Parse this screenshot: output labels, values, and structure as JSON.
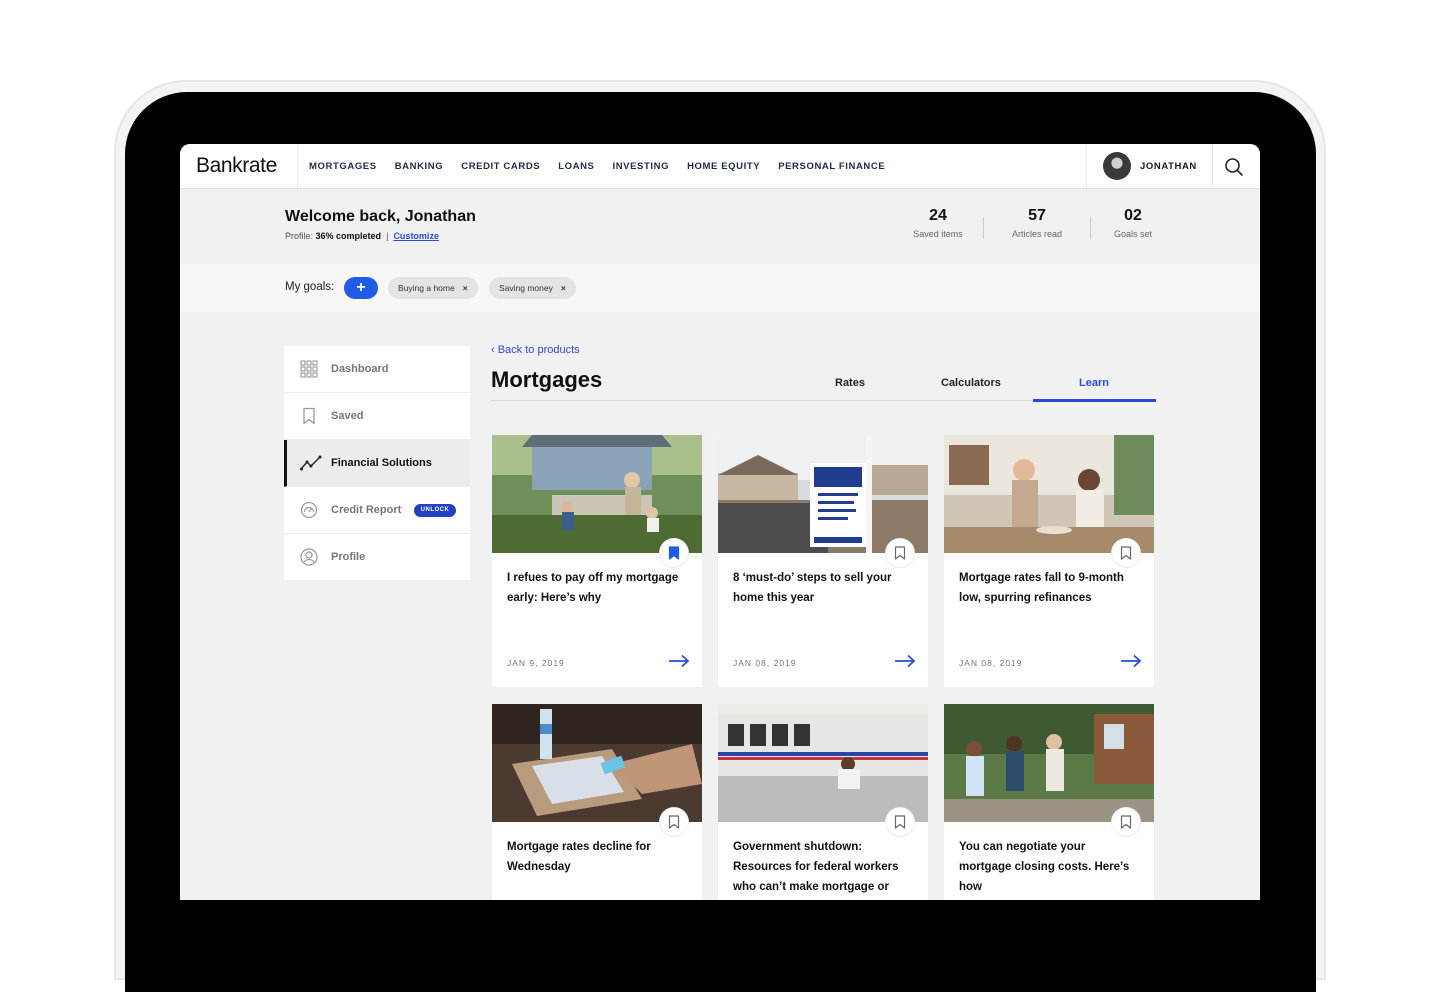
{
  "brand": {
    "logo": "Bankrate"
  },
  "nav": {
    "items": [
      "MORTGAGES",
      "BANKING",
      "CREDIT CARDS",
      "LOANS",
      "INVESTING",
      "HOME EQUITY",
      "PERSONAL FINANCE"
    ],
    "user_name": "JONATHAN"
  },
  "welcome": {
    "title": "Welcome back, Jonathan",
    "profile_prefix": "Profile:",
    "profile_completed": "36% completed",
    "separator": "|",
    "customize": "Customize"
  },
  "stats": [
    {
      "value": "24",
      "label": "Saved items"
    },
    {
      "value": "57",
      "label": "Articles read"
    },
    {
      "value": "02",
      "label": "Goals set"
    }
  ],
  "goals": {
    "label": "My goals:",
    "add": "+",
    "chips": [
      "Buying a home",
      "Saving money"
    ],
    "remove": "×"
  },
  "sidebar": {
    "items": [
      {
        "label": "Dashboard",
        "icon": "grid-icon"
      },
      {
        "label": "Saved",
        "icon": "bookmark-icon"
      },
      {
        "label": "Financial Solutions",
        "icon": "trend-line-icon",
        "active": true
      },
      {
        "label": "Credit Report",
        "icon": "gauge-icon",
        "badge": "UNLOCK"
      },
      {
        "label": "Profile",
        "icon": "user-circle-icon"
      }
    ]
  },
  "main": {
    "back_link": "‹ Back to products",
    "title": "Mortgages",
    "tabs": [
      "Rates",
      "Calculators",
      "Learn"
    ],
    "active_tab": "Learn"
  },
  "cards": [
    {
      "title": "I refues to pay off my mortgage early: Here’s why",
      "date": "JAN 9, 2019",
      "saved": true,
      "image": "family gardening in backyard"
    },
    {
      "title": "8 ‘must-do’ steps to sell your home this year",
      "date": "JAN 08, 2019",
      "saved": false,
      "image": "Coldwell Banker for-sale sign"
    },
    {
      "title": "Mortgage rates fall to 9-month low, spurring refinances",
      "date": "JAN 08, 2019",
      "saved": false,
      "image": "two women in kitchen"
    },
    {
      "title": "Mortgage rates decline for Wednesday",
      "date": "",
      "saved": false,
      "image": "hands using phone and tablet"
    },
    {
      "title": "Government shutdown: Resources for federal workers who can’t make mortgage or",
      "date": "",
      "saved": false,
      "image": "subway train at platform"
    },
    {
      "title": "You can negotiate your mortgage closing costs. Here’s how",
      "date": "",
      "saved": false,
      "image": "family greeting neighbor"
    }
  ],
  "colors": {
    "accent": "#2a4bd7",
    "add_button": "#1e5be6",
    "badge": "#2140c4"
  }
}
